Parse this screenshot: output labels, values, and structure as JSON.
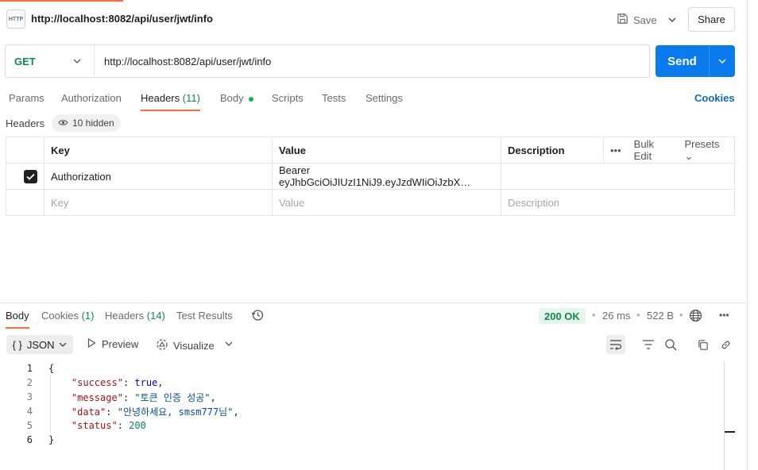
{
  "request": {
    "title": "http://localhost:8082/api/user/jwt/info",
    "icon_text": "HTTP",
    "method": "GET",
    "url": "http://localhost:8082/api/user/jwt/info",
    "save_label": "Save",
    "share_label": "Share",
    "send_label": "Send"
  },
  "tabs": {
    "params": "Params",
    "authorization": "Authorization",
    "headers": "Headers",
    "headers_count": "(11)",
    "body": "Body",
    "scripts": "Scripts",
    "tests": "Tests",
    "settings": "Settings",
    "cookies": "Cookies"
  },
  "headers_section": {
    "label": "Headers",
    "hidden": "10 hidden",
    "columns": {
      "key": "Key",
      "value": "Value",
      "description": "Description"
    },
    "bulk_edit": "Bulk Edit",
    "presets": "Presets",
    "rows": [
      {
        "checked": true,
        "key": "Authorization",
        "value": "Bearer  eyJhbGciOiJIUzI1NiJ9.eyJzdWIiOiJzbX…",
        "description": ""
      }
    ],
    "placeholder": {
      "key": "Key",
      "value": "Value",
      "description": "Description"
    }
  },
  "response": {
    "tabs": {
      "body": "Body",
      "cookies": "Cookies",
      "cookies_count": "(1)",
      "headers": "Headers",
      "headers_count": "(14)",
      "test_results": "Test Results"
    },
    "status": "200 OK",
    "time": "26 ms",
    "size": "522 B",
    "format": "JSON",
    "preview": "Preview",
    "visualize": "Visualize",
    "lines": [
      "1",
      "2",
      "3",
      "4",
      "5",
      "6"
    ],
    "json": {
      "open": "{",
      "close": "}",
      "success_key": "\"success\"",
      "success_val": "true",
      "message_key": "\"message\"",
      "message_val": "\"토큰 인증 성공\"",
      "data_key": "\"data\"",
      "data_val": "\"안녕하세요, smsm777님\"",
      "status_key": "\"status\"",
      "status_val": "200"
    }
  },
  "colors": {
    "accent": "#ff6c37",
    "send": "#097bed",
    "success": "#0f8a4d",
    "link": "#0a6bce"
  }
}
